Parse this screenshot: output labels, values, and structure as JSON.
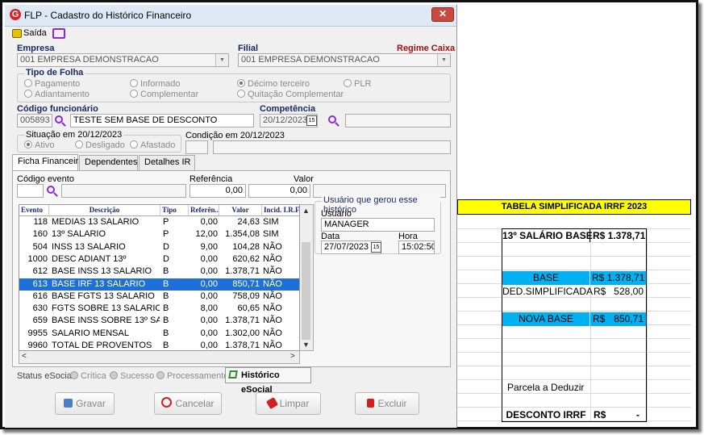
{
  "window": {
    "title": "FLP - Cadastro do Histórico Financeiro",
    "close": "✕"
  },
  "toolbar": {
    "exit_label": "Saída"
  },
  "empresa": {
    "label": "Empresa",
    "value": "001 EMPRESA DEMONSTRACAO"
  },
  "filial": {
    "label": "Filial",
    "value": "001 EMPRESA DEMONSTRACAO",
    "regime": "Regime Caixa"
  },
  "tipo_folha": {
    "label": "Tipo de Folha",
    "options": [
      "Pagamento",
      "Adiantamento",
      "Informado",
      "Complementar",
      "Décimo terceiro",
      "Quitação Complementar",
      "PLR"
    ],
    "selected": "Décimo terceiro"
  },
  "funcionario": {
    "label": "Código funcionário",
    "code": "005893",
    "name": "TESTE SEM BASE DE DESCONTO"
  },
  "competencia": {
    "label": "Competência",
    "value": "20/12/2023",
    "cal": "15"
  },
  "situacao": {
    "label": "Situação em 20/12/2023",
    "options": [
      "Ativo",
      "Desligado",
      "Afastado"
    ],
    "selected": "Ativo"
  },
  "condicao": {
    "label": "Condição em 20/12/2023"
  },
  "tabs": [
    "Ficha Financeira",
    "Dependentes",
    "Detalhes IR"
  ],
  "entry": {
    "evento_label": "Código evento",
    "referencia_label": "Referência",
    "valor_label": "Valor",
    "referencia": "0,00",
    "valor": "0,00"
  },
  "grid": {
    "headers": [
      "Evento",
      "Descrição",
      "Tipo",
      "Referên..",
      "Valor",
      "Incid. I.R.F."
    ],
    "rows": [
      [
        "118",
        "MEDIAS 13 SALARIO",
        "P",
        "0,00",
        "24,63",
        "SIM"
      ],
      [
        "160",
        "13º SALARIO",
        "P",
        "12,00",
        "1.354,08",
        "SIM"
      ],
      [
        "504",
        "INSS 13 SALARIO",
        "D",
        "9,00",
        "104,28",
        "NÃO"
      ],
      [
        "1000",
        "DESC ADIANT 13º",
        "D",
        "0,00",
        "620,62",
        "NÃO"
      ],
      [
        "612",
        "BASE INSS 13 SALARIO",
        "B",
        "0,00",
        "1.378,71",
        "NÃO"
      ],
      [
        "613",
        "BASE IRF 13 SALARIO",
        "B",
        "0,00",
        "850,71",
        "NÃO"
      ],
      [
        "616",
        "BASE FGTS 13 SALARIO",
        "B",
        "0,00",
        "758,09",
        "NÃO"
      ],
      [
        "630",
        "FGTS SOBRE 13 SALARIO",
        "B",
        "8,00",
        "60,65",
        "NÃO"
      ],
      [
        "659",
        "BASE INSS SOBRE 13º SA",
        "B",
        "0,00",
        "1.378,71",
        "NÃO"
      ],
      [
        "9955",
        "SALARIO MENSAL",
        "B",
        "0,00",
        "1.302,00",
        "NÃO"
      ],
      [
        "9960",
        "TOTAL DE PROVENTOS",
        "B",
        "0,00",
        "1.378,71",
        "NÃO"
      ]
    ],
    "selected_index": 5
  },
  "historico": {
    "legend": "Usuário que gerou esse histórico",
    "usuario_label": "Usuário",
    "usuario": "MANAGER",
    "data_label": "Data",
    "data": "27/07/2023",
    "cal": "15",
    "hora_label": "Hora",
    "hora": "15:02:50"
  },
  "esocial": {
    "label": "Status eSocial:",
    "options": [
      "Crítica",
      "Sucesso",
      "Processamento"
    ],
    "button": "Histórico eSocial"
  },
  "buttons": {
    "gravar": "Gravar",
    "cancelar": "Cancelar",
    "limpar": "Limpar",
    "excluir": "Excluir"
  },
  "sheet": {
    "title": "TABELA SIMPLIFICADA IRRF 2023",
    "salario_label": "13º SALÁRIO BASE",
    "salario_value": "R$ 1.378,71",
    "base_label": "BASE",
    "base_value": "R$ 1.378,71",
    "ded_label": "DED.SIMPLIFICADA",
    "ded_currency": "R$",
    "ded_value": "528,00",
    "nova_label": "NOVA BASE",
    "nova_currency": "R$",
    "nova_value": "850,71",
    "parcela_label": "Parcela a Deduzir",
    "desconto_label": "DESCONTO IRRF",
    "desconto_currency": "R$",
    "desconto_value": "-"
  },
  "colors": {
    "accent": "#1e6fd9",
    "label_blue": "#16285f",
    "cyan": "#00b0f0",
    "yellow": "#ffff00"
  }
}
